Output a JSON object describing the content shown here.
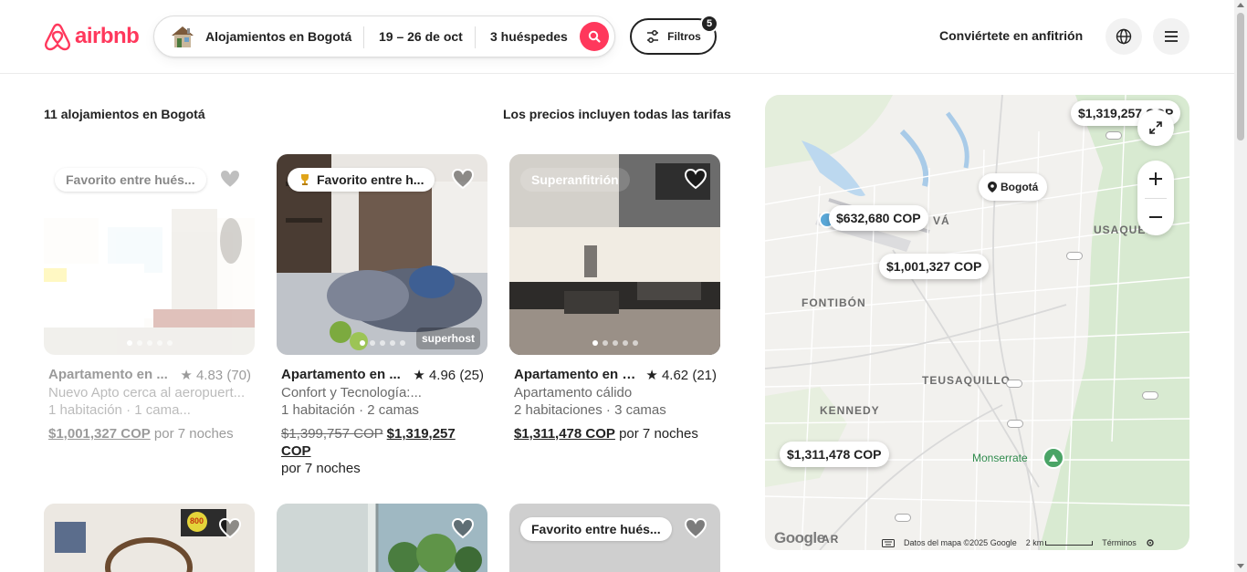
{
  "header": {
    "logo_text": "airbnb",
    "search": {
      "location": "Alojamientos en Bogotá",
      "dates": "19 – 26 de oct",
      "guests": "3 huéspedes"
    },
    "filters": {
      "label": "Filtros",
      "count": "5"
    },
    "host_link": "Conviértete en anfitrión"
  },
  "results": {
    "count_label": "11 alojamientos en Bogotá",
    "price_note": "Los precios incluyen todas las tarifas"
  },
  "listings": [
    {
      "badge": "Favorito entre hués...",
      "title": "Apartamento en ...",
      "rating": "★ 4.83 (70)",
      "subtitle": "Nuevo Apto cerca al aeropuert...",
      "details": "1 habitación · 1 cama...",
      "price": "$1,001,327 COP",
      "price_suffix": " por 7 noches"
    },
    {
      "badge": "Favorito entre h...",
      "title": "Apartamento en ...",
      "rating": "★ 4.96 (25)",
      "subtitle": "Confort y Tecnología:...",
      "details": "1 habitación · 2 camas",
      "old_price": "$1,399,757 COP",
      "price": "$1,319,257 COP",
      "price_suffix": "por 7 noches",
      "superhost_mark": "superhost"
    },
    {
      "badge": "Superanfitrión",
      "title": "Apartamento en K...",
      "rating": "★ 4.62 (21)",
      "subtitle": "Apartamento cálido",
      "details": "2 habitaciones · 3 camas",
      "price": "$1,311,478 COP",
      "price_suffix": " por 7 noches"
    }
  ],
  "second_row": {
    "badge_3": "Favorito entre hués...",
    "tv_sign": "800"
  },
  "map": {
    "city_chip": "Bogotá",
    "labels": [
      "FONTIBÓN",
      "USAQUÉN",
      "TEUSAQUILLO",
      "KENNEDY",
      "VÁ",
      "AR"
    ],
    "monserrate": "Monserrate",
    "pins": [
      "$1,319,257 COP",
      "$632,680 COP",
      "$1,001,327 COP",
      "$1,311,478 COP"
    ],
    "google": "Google",
    "footer": {
      "data": "Datos del mapa ©2025 Google",
      "scale": "2 km",
      "terms": "Términos"
    }
  },
  "colors": {
    "brand": "#ff385c",
    "text": "#222222",
    "muted": "#6a6a6a"
  }
}
